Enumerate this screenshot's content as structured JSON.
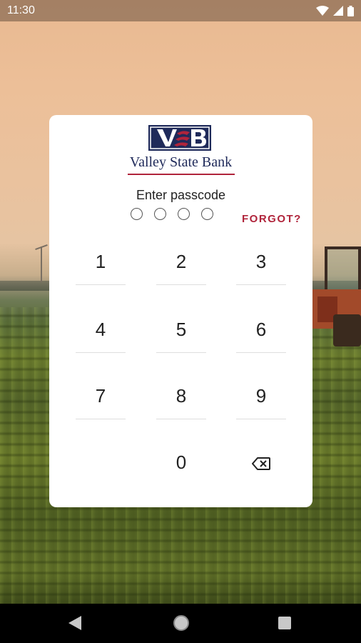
{
  "status_bar": {
    "time": "11:30",
    "icons": [
      "wifi-icon",
      "signal-icon",
      "battery-icon"
    ]
  },
  "brand": {
    "logo_text": "VSB",
    "name": "Valley State Bank",
    "colors": {
      "navy": "#1f2a5a",
      "red": "#b0243b"
    }
  },
  "passcode": {
    "label": "Enter passcode",
    "digits_entered": 0,
    "digits_total": 4,
    "forgot_label": "FORGOT?"
  },
  "keypad": {
    "keys": [
      "1",
      "2",
      "3",
      "4",
      "5",
      "6",
      "7",
      "8",
      "9",
      "",
      "0",
      "backspace-icon"
    ]
  },
  "nav_bar": {
    "icons": [
      "back-icon",
      "home-icon",
      "recents-icon"
    ]
  }
}
